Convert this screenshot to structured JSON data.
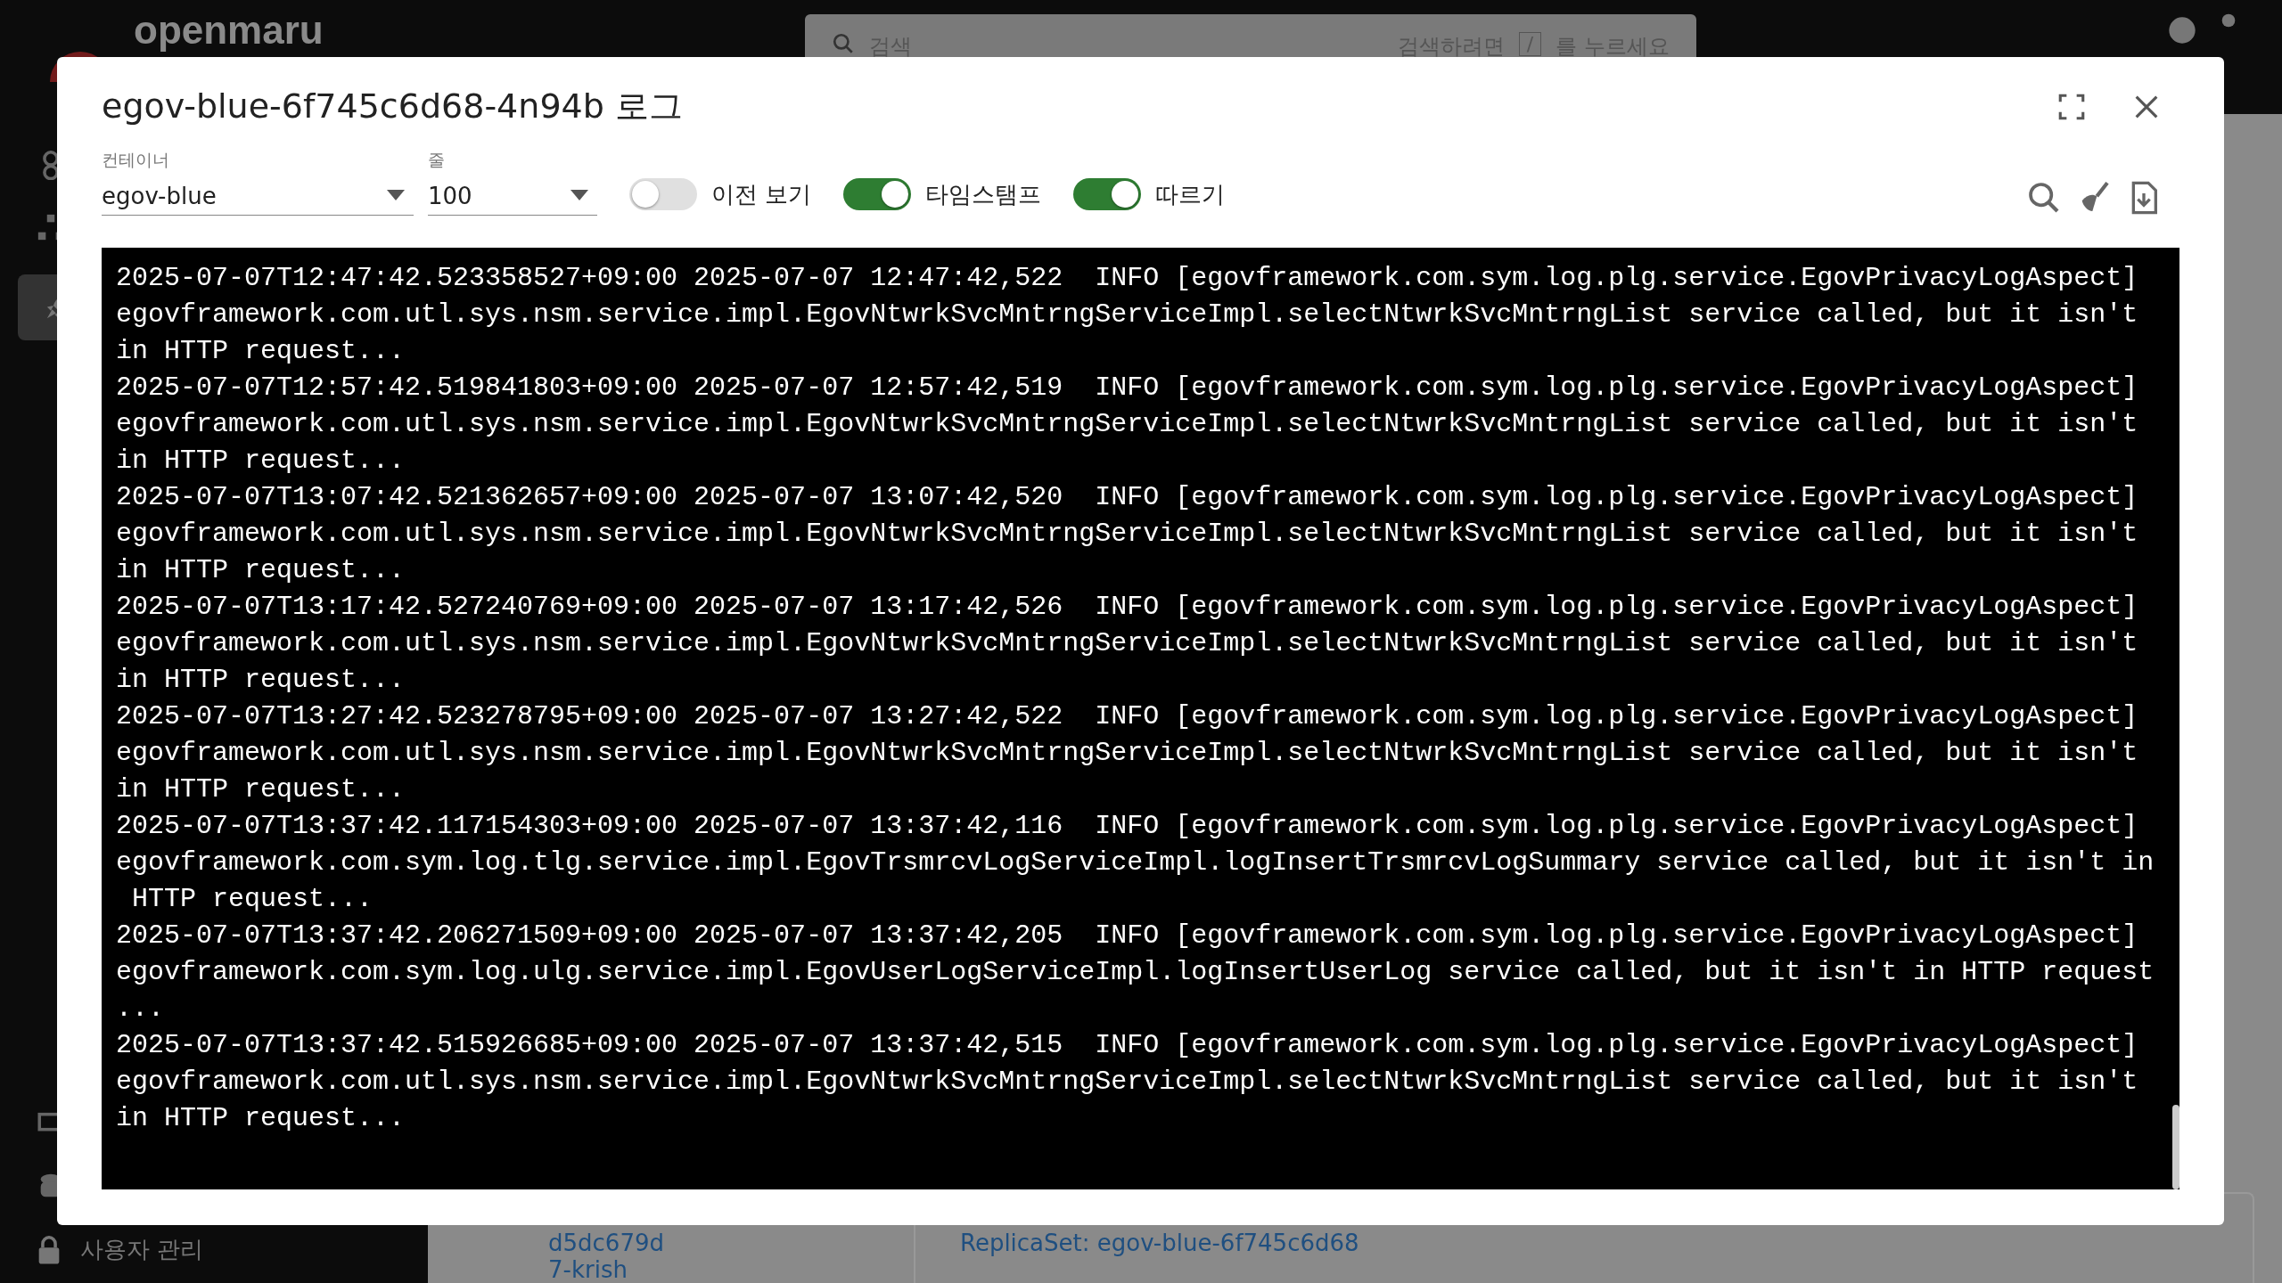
{
  "header": {
    "logo": "openmaru",
    "search": {
      "placeholder": "검색",
      "hint_before": "검색하려면",
      "key": "/",
      "hint_after": "를 누르세요"
    }
  },
  "sidebar": {
    "bottom_item": "사용자 관리"
  },
  "background": {
    "texts": [
      "d5dc679d",
      "7-krish"
    ],
    "link": "ReplicaSet: egov-blue-6f745c6d68"
  },
  "dialog": {
    "title": "egov-blue-6f745c6d68-4n94b 로그",
    "container": {
      "label": "컨테이너",
      "value": "egov-blue"
    },
    "lines_select": {
      "label": "줄",
      "value": "100"
    },
    "toggles": [
      {
        "label": "이전 보기",
        "on": false
      },
      {
        "label": "타임스탬프",
        "on": true
      },
      {
        "label": "따르기",
        "on": true
      }
    ],
    "log": [
      {
        "lines": [
          "2025-07-07T12:47:42.523358527+09:00 2025-07-07 12:47:42,522  INFO [egovframework.com.sym.log.plg.service.EgovPrivacyLogAspect]",
          "egovframework.com.utl.sys.nsm.service.impl.EgovNtwrkSvcMntrngServiceImpl.selectNtwrkSvcMntrngList service called, but it isn't",
          "in HTTP request..."
        ]
      },
      {
        "lines": [
          "2025-07-07T12:57:42.519841803+09:00 2025-07-07 12:57:42,519  INFO [egovframework.com.sym.log.plg.service.EgovPrivacyLogAspect]",
          "egovframework.com.utl.sys.nsm.service.impl.EgovNtwrkSvcMntrngServiceImpl.selectNtwrkSvcMntrngList service called, but it isn't",
          "in HTTP request..."
        ]
      },
      {
        "lines": [
          "2025-07-07T13:07:42.521362657+09:00 2025-07-07 13:07:42,520  INFO [egovframework.com.sym.log.plg.service.EgovPrivacyLogAspect]",
          "egovframework.com.utl.sys.nsm.service.impl.EgovNtwrkSvcMntrngServiceImpl.selectNtwrkSvcMntrngList service called, but it isn't",
          "in HTTP request..."
        ]
      },
      {
        "lines": [
          "2025-07-07T13:17:42.527240769+09:00 2025-07-07 13:17:42,526  INFO [egovframework.com.sym.log.plg.service.EgovPrivacyLogAspect]",
          "egovframework.com.utl.sys.nsm.service.impl.EgovNtwrkSvcMntrngServiceImpl.selectNtwrkSvcMntrngList service called, but it isn't",
          "in HTTP request..."
        ]
      },
      {
        "lines": [
          "2025-07-07T13:27:42.523278795+09:00 2025-07-07 13:27:42,522  INFO [egovframework.com.sym.log.plg.service.EgovPrivacyLogAspect]",
          "egovframework.com.utl.sys.nsm.service.impl.EgovNtwrkSvcMntrngServiceImpl.selectNtwrkSvcMntrngList service called, but it isn't",
          "in HTTP request..."
        ]
      },
      {
        "lines": [
          "2025-07-07T13:37:42.117154303+09:00 2025-07-07 13:37:42,116  INFO [egovframework.com.sym.log.plg.service.EgovPrivacyLogAspect]",
          "egovframework.com.sym.log.tlg.service.impl.EgovTrsmrcvLogServiceImpl.logInsertTrsmrcvLogSummary service called, but it isn't in",
          " HTTP request..."
        ]
      },
      {
        "lines": [
          "2025-07-07T13:37:42.206271509+09:00 2025-07-07 13:37:42,205  INFO [egovframework.com.sym.log.plg.service.EgovPrivacyLogAspect]",
          "egovframework.com.sym.log.ulg.service.impl.EgovUserLogServiceImpl.logInsertUserLog service called, but it isn't in HTTP request",
          "..."
        ]
      },
      {
        "lines": [
          "2025-07-07T13:37:42.515926685+09:00 2025-07-07 13:37:42,515  INFO [egovframework.com.sym.log.plg.service.EgovPrivacyLogAspect]",
          "egovframework.com.utl.sys.nsm.service.impl.EgovNtwrkSvcMntrngServiceImpl.selectNtwrkSvcMntrngList service called, but it isn't",
          "in HTTP request..."
        ]
      }
    ]
  }
}
